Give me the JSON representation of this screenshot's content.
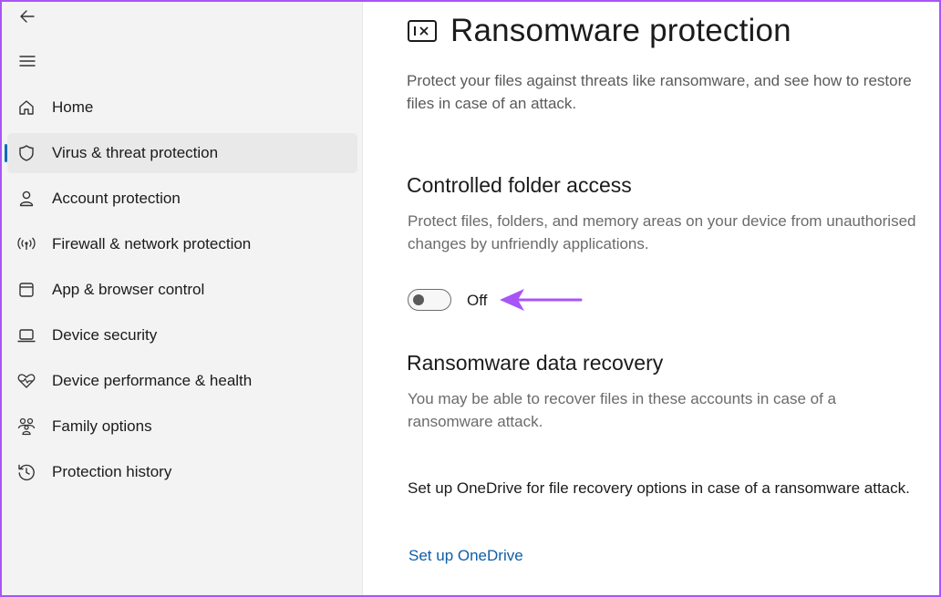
{
  "sidebar": {
    "items": [
      {
        "label": "Home",
        "icon": "home-icon"
      },
      {
        "label": "Virus & threat protection",
        "icon": "shield-icon",
        "selected": true
      },
      {
        "label": "Account protection",
        "icon": "person-icon"
      },
      {
        "label": "Firewall & network protection",
        "icon": "wifi-antenna-icon"
      },
      {
        "label": "App & browser control",
        "icon": "app-window-icon"
      },
      {
        "label": "Device security",
        "icon": "laptop-icon"
      },
      {
        "label": "Device performance & health",
        "icon": "heart-pulse-icon"
      },
      {
        "label": "Family options",
        "icon": "family-icon"
      },
      {
        "label": "Protection history",
        "icon": "history-icon"
      }
    ]
  },
  "main": {
    "title": "Ransomware protection",
    "description": "Protect your files against threats like ransomware, and see how to restore files in case of an attack.",
    "controlled_folder": {
      "heading": "Controlled folder access",
      "description": "Protect files, folders, and memory areas on your device from unauthorised changes by unfriendly applications.",
      "toggle_state": "Off"
    },
    "recovery": {
      "heading": "Ransomware data recovery",
      "description": "You may be able to recover files in these accounts in case of a ransomware attack.",
      "onedrive_text": "Set up OneDrive for file recovery options in case of a ransomware attack.",
      "onedrive_link": "Set up OneDrive"
    }
  },
  "colors": {
    "accent": "#0f6cbd",
    "annotation_arrow": "#a855f7",
    "frame_border": "#a855f7",
    "link": "#0f5ea8"
  }
}
